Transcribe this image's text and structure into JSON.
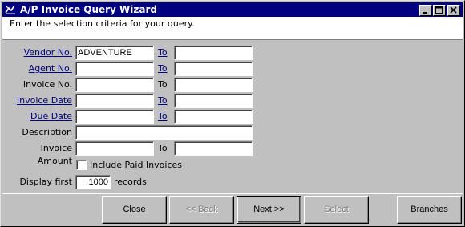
{
  "window": {
    "title": "A/P Invoice Query Wizard",
    "icon": "app-icon"
  },
  "header": {
    "instruction": "Enter the selection criteria for your query."
  },
  "form": {
    "vendor_label": "Vendor No.",
    "vendor_from": "ADVENTURE",
    "vendor_to": "",
    "agent_label": "Agent No.",
    "agent_from": "",
    "agent_to": "",
    "invoice_no_label": "Invoice No.",
    "invoice_no_from": "",
    "invoice_no_to": "",
    "invoice_date_label": "Invoice Date",
    "invoice_date_from": "",
    "invoice_date_to": "",
    "due_date_label": "Due Date",
    "due_date_from": "",
    "due_date_to": "",
    "description_label": "Description",
    "description_value": "",
    "amount_label": "Invoice Amount",
    "amount_from": "",
    "amount_to": "",
    "to_label": "To",
    "include_paid_label": "Include Paid Invoices",
    "include_paid_checked": false,
    "display_first_label": "Display first",
    "display_first_value": "1000",
    "records_label": "records"
  },
  "buttons": {
    "close": "Close",
    "back": "<< Back",
    "next": "Next >>",
    "select": "Select",
    "branches": "Branches"
  },
  "colors": {
    "titlebar": "#000080",
    "face": "#c0c0c0",
    "link": "#000080"
  }
}
